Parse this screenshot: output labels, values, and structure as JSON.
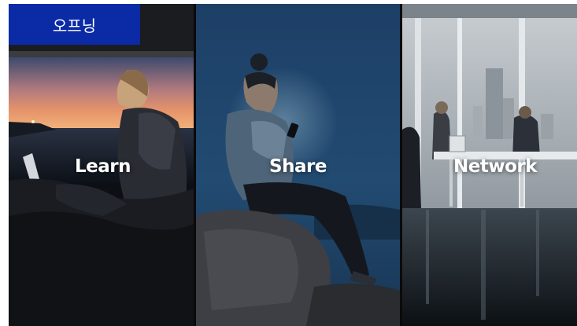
{
  "overlay": {
    "tag_label": "오프닝"
  },
  "panels": [
    {
      "label": "Learn"
    },
    {
      "label": "Share"
    },
    {
      "label": "Network"
    }
  ],
  "colors": {
    "tag_bg": "#0b2aa6",
    "label_text": "#ffffff"
  }
}
